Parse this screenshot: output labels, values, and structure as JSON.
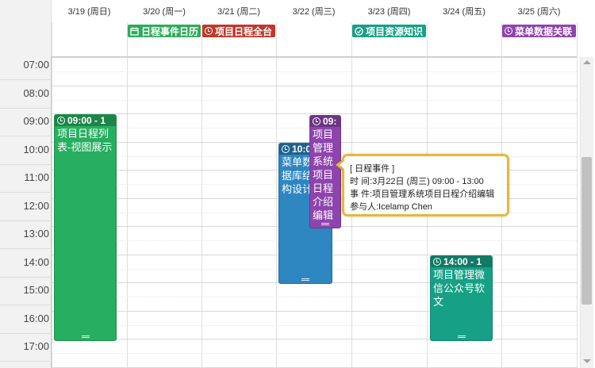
{
  "days": [
    {
      "label": "3/19 (周日)"
    },
    {
      "label": "3/20 (周一)"
    },
    {
      "label": "3/21 (周二)"
    },
    {
      "label": "3/22 (周三)"
    },
    {
      "label": "3/23 (周四)"
    },
    {
      "label": "3/24 (周五)"
    },
    {
      "label": "3/25 (周六)"
    }
  ],
  "hours": [
    "07:00",
    "08:00",
    "09:00",
    "10:00",
    "11:00",
    "12:00",
    "13:00",
    "14:00",
    "15:00",
    "16:00",
    "17:00"
  ],
  "allday_events": [
    {
      "title": "日程事件日历",
      "icon": "calendar-icon",
      "color": "#2faa5c"
    },
    {
      "title": "项目日程全台",
      "icon": "alarm-clock-icon",
      "color": "#c0392b"
    },
    {
      "title": "项目资源知识",
      "icon": "resource-icon",
      "color": "#17a085"
    },
    {
      "title": "菜单数据关联",
      "icon": "menu-icon",
      "color": "#8e44ad"
    }
  ],
  "timed_events": [
    {
      "time": "09:00 - 1",
      "title": "项目日程列表-视图展示",
      "color": "#27ae60"
    },
    {
      "time": "10:0",
      "title": "菜单数据库结构设计",
      "color": "#2e86c1"
    },
    {
      "time": "09:",
      "title": "项目管理系统项目日程介绍编辑",
      "color": "#8e44ad"
    },
    {
      "time": "14:00 - 1",
      "title": "项目管理微信公众号软文",
      "color": "#16a085"
    }
  ],
  "tooltip": {
    "type": "[ 日程事件 ]",
    "time_line": "时 间:3月22日 (周三) 09:00 - 13:00",
    "event_line": "事 件:项目管理系统项目日程介绍编辑",
    "participant_line": "参与人:Icelamp Chen",
    "border_color": "#e6b83a"
  }
}
